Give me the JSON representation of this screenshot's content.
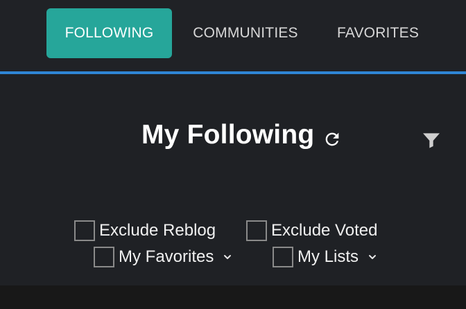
{
  "tabs": [
    {
      "label": "FOLLOWING",
      "active": true
    },
    {
      "label": "COMMUNITIES",
      "active": false
    },
    {
      "label": "FAVORITES",
      "active": false
    }
  ],
  "main": {
    "title": "My Following",
    "refresh_icon": "refresh-icon",
    "filter_icon": "filter-icon"
  },
  "options": {
    "exclude_reblog": {
      "label": "Exclude Reblog",
      "checked": false
    },
    "exclude_voted": {
      "label": "Exclude Voted",
      "checked": false
    },
    "my_favorites": {
      "label": "My Favorites",
      "checked": false
    },
    "my_lists": {
      "label": "My Lists",
      "checked": false
    }
  },
  "colors": {
    "accent": "#26a69a",
    "divider": "#2f86d6",
    "background": "#1f2125"
  }
}
